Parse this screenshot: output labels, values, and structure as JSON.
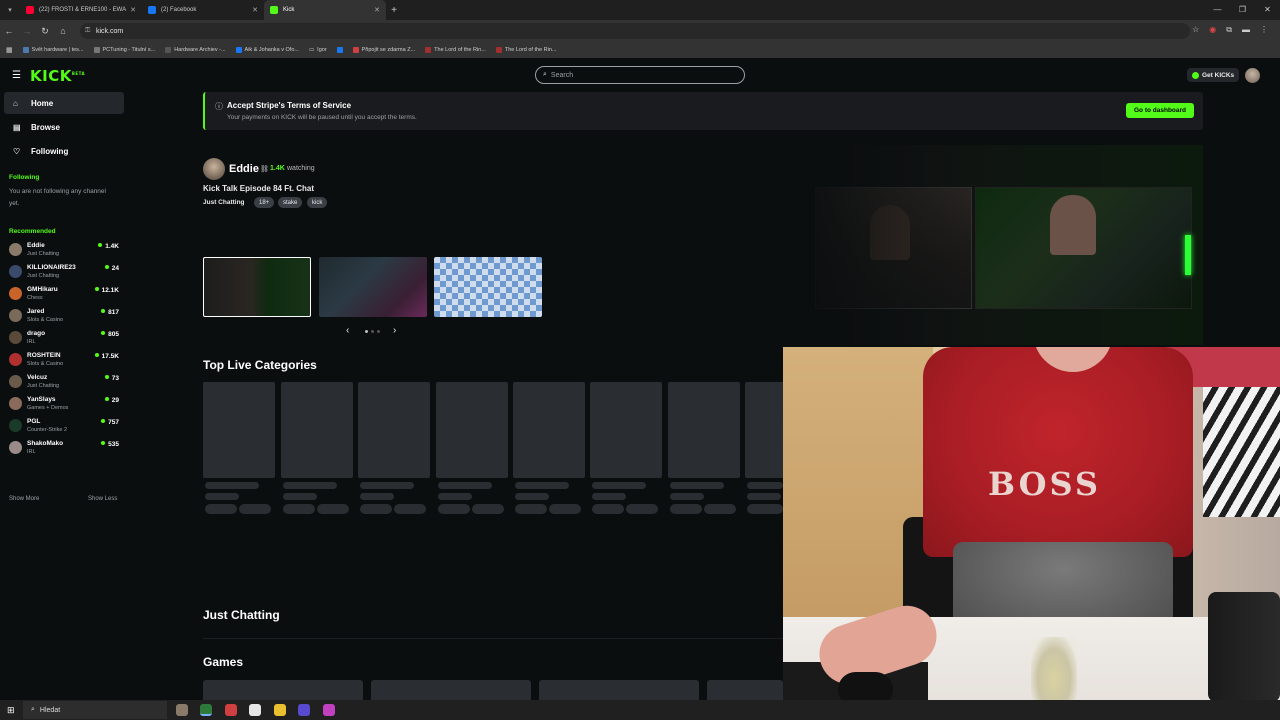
{
  "browser": {
    "tabs": [
      {
        "label": "(22) FROSTI & ERNE100 - EWA",
        "color": "#ff0033",
        "active": false
      },
      {
        "label": "(2) Facebook",
        "color": "#1877f2",
        "active": false
      },
      {
        "label": "Kick",
        "color": "#53fc18",
        "active": true
      }
    ],
    "url": "kick.com",
    "bookmarks": [
      {
        "label": "Svět hardware | tes..."
      },
      {
        "label": "PCTuning - Titulní s..."
      },
      {
        "label": "Hardware Archiev -..."
      },
      {
        "label": "Aik & Johanka v Ofo..."
      },
      {
        "label": "Igor"
      },
      {
        "label": ""
      },
      {
        "label": "Připojit se zdarma Z..."
      },
      {
        "label": "The Lord of the Rin..."
      },
      {
        "label": "The Lord of the Rin..."
      }
    ]
  },
  "header": {
    "logo": "KICK",
    "logo_badge": "BETA",
    "search_placeholder": "Search",
    "get_kicks": "Get KICKs"
  },
  "sidebar": {
    "nav": [
      {
        "label": "Home",
        "icon": "home-icon",
        "active": true
      },
      {
        "label": "Browse",
        "icon": "browse-icon",
        "active": false
      },
      {
        "label": "Following",
        "icon": "heart-icon",
        "active": false
      }
    ],
    "following_heading": "Following",
    "following_empty": "You are not following any channel yet.",
    "recommended_heading": "Recommended",
    "recommended": [
      {
        "name": "Eddie",
        "category": "Just Chatting",
        "viewers": "1.4K",
        "color": "#8a7a6a"
      },
      {
        "name": "KILLIONAIRE23",
        "category": "Just Chatting",
        "viewers": "24",
        "color": "#3a4a6a"
      },
      {
        "name": "GMHikaru",
        "category": "Chess",
        "viewers": "12.1K",
        "color": "#c8642a"
      },
      {
        "name": "Jared",
        "category": "Slots & Casino",
        "viewers": "817",
        "color": "#7a6a5a"
      },
      {
        "name": "drago",
        "category": "IRL",
        "viewers": "805",
        "color": "#5a4a3a"
      },
      {
        "name": "ROSHTEIN",
        "category": "Slots & Casino",
        "viewers": "17.5K",
        "color": "#b03030"
      },
      {
        "name": "Velcuz",
        "category": "Just Chatting",
        "viewers": "73",
        "color": "#6a5a4a"
      },
      {
        "name": "YanSlays",
        "category": "Games + Demos",
        "viewers": "29",
        "color": "#8a6a5a"
      },
      {
        "name": "PGL",
        "category": "Counter-Strike 2",
        "viewers": "757",
        "color": "#1a3a2a"
      },
      {
        "name": "ShakoMako",
        "category": "IRL",
        "viewers": "535",
        "color": "#9a8a8a"
      }
    ],
    "show_more": "Show More",
    "show_less": "Show Less"
  },
  "banner": {
    "title": "Accept Stripe's Terms of Service",
    "subtitle": "Your payments on KICK will be paused until you accept the terms.",
    "button": "Go to dashboard"
  },
  "featured": {
    "streamer": "Eddie",
    "viewers": "1.4K",
    "watching_label": "watching",
    "title": "Kick Talk Episode 84 Ft. Chat",
    "category": "Just Chatting",
    "tags": [
      "18+",
      "stake",
      "kick"
    ]
  },
  "sections": {
    "top_live_categories": "Top Live Categories",
    "just_chatting": "Just Chatting",
    "games": "Games"
  },
  "taskbar": {
    "search_placeholder": "Hledat"
  }
}
